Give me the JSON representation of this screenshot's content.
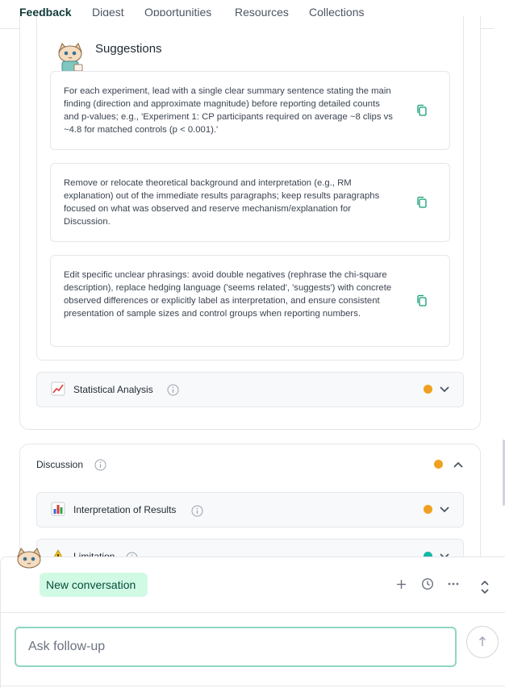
{
  "tabs": [
    "Feedback",
    "Digest",
    "Opportunities",
    "Resources",
    "Collections"
  ],
  "suggestions": {
    "title": "Suggestions",
    "items": [
      "For each experiment, lead with a single clear summary sentence stating the main finding (direction and approximate magnitude) before reporting detailed counts and p-values; e.g., 'Experiment 1: CP participants required on average ~8 clips vs ~4.8 for matched controls (p < 0.001).'",
      "Remove or relocate theoretical background and interpretation (e.g., RM explanation) out of the immediate results paragraphs; keep results paragraphs focused on what was observed and reserve mechanism/explanation for Discussion.",
      "Edit specific unclear phrasings: avoid double negatives (rephrase the chi-square description), replace hedging language ('seems related', 'suggests') with concrete observed differences or explicitly label as interpretation, and ensure consistent presentation of sample sizes and control groups when reporting numbers."
    ]
  },
  "sections": {
    "statistical_analysis": {
      "label": "Statistical Analysis",
      "icon": "chart-increasing-icon",
      "status_color": "#f0a020"
    },
    "discussion": {
      "label": "Discussion",
      "status_color": "#f0a020"
    },
    "interpretation": {
      "label": "Interpretation of Results",
      "icon": "bar-chart-icon",
      "status_color": "#f0a020"
    },
    "limitation": {
      "label": "Limitation",
      "icon": "warning-icon",
      "status_color": "#14b8a6"
    }
  },
  "chat": {
    "new_conversation_label": "New conversation",
    "input_placeholder": "Ask follow-up"
  },
  "colors": {
    "accent": "#0f766e",
    "new_conversation_bg": "#d1fae5",
    "input_border": "#8fd6c3"
  }
}
